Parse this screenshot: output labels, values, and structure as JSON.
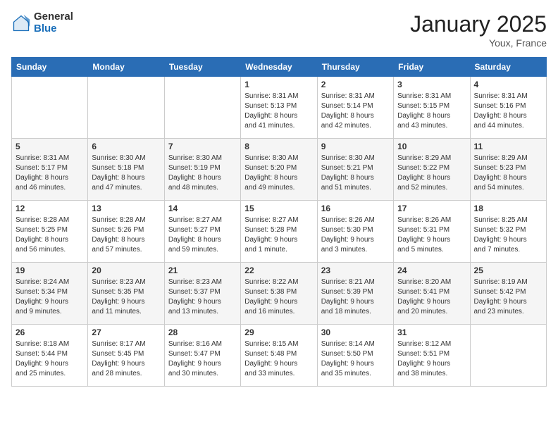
{
  "header": {
    "logo_general": "General",
    "logo_blue": "Blue",
    "month_title": "January 2025",
    "location": "Youx, France"
  },
  "days_of_week": [
    "Sunday",
    "Monday",
    "Tuesday",
    "Wednesday",
    "Thursday",
    "Friday",
    "Saturday"
  ],
  "weeks": [
    [
      {
        "day": "",
        "info": ""
      },
      {
        "day": "",
        "info": ""
      },
      {
        "day": "",
        "info": ""
      },
      {
        "day": "1",
        "info": "Sunrise: 8:31 AM\nSunset: 5:13 PM\nDaylight: 8 hours\nand 41 minutes."
      },
      {
        "day": "2",
        "info": "Sunrise: 8:31 AM\nSunset: 5:14 PM\nDaylight: 8 hours\nand 42 minutes."
      },
      {
        "day": "3",
        "info": "Sunrise: 8:31 AM\nSunset: 5:15 PM\nDaylight: 8 hours\nand 43 minutes."
      },
      {
        "day": "4",
        "info": "Sunrise: 8:31 AM\nSunset: 5:16 PM\nDaylight: 8 hours\nand 44 minutes."
      }
    ],
    [
      {
        "day": "5",
        "info": "Sunrise: 8:31 AM\nSunset: 5:17 PM\nDaylight: 8 hours\nand 46 minutes."
      },
      {
        "day": "6",
        "info": "Sunrise: 8:30 AM\nSunset: 5:18 PM\nDaylight: 8 hours\nand 47 minutes."
      },
      {
        "day": "7",
        "info": "Sunrise: 8:30 AM\nSunset: 5:19 PM\nDaylight: 8 hours\nand 48 minutes."
      },
      {
        "day": "8",
        "info": "Sunrise: 8:30 AM\nSunset: 5:20 PM\nDaylight: 8 hours\nand 49 minutes."
      },
      {
        "day": "9",
        "info": "Sunrise: 8:30 AM\nSunset: 5:21 PM\nDaylight: 8 hours\nand 51 minutes."
      },
      {
        "day": "10",
        "info": "Sunrise: 8:29 AM\nSunset: 5:22 PM\nDaylight: 8 hours\nand 52 minutes."
      },
      {
        "day": "11",
        "info": "Sunrise: 8:29 AM\nSunset: 5:23 PM\nDaylight: 8 hours\nand 54 minutes."
      }
    ],
    [
      {
        "day": "12",
        "info": "Sunrise: 8:28 AM\nSunset: 5:25 PM\nDaylight: 8 hours\nand 56 minutes."
      },
      {
        "day": "13",
        "info": "Sunrise: 8:28 AM\nSunset: 5:26 PM\nDaylight: 8 hours\nand 57 minutes."
      },
      {
        "day": "14",
        "info": "Sunrise: 8:27 AM\nSunset: 5:27 PM\nDaylight: 8 hours\nand 59 minutes."
      },
      {
        "day": "15",
        "info": "Sunrise: 8:27 AM\nSunset: 5:28 PM\nDaylight: 9 hours\nand 1 minute."
      },
      {
        "day": "16",
        "info": "Sunrise: 8:26 AM\nSunset: 5:30 PM\nDaylight: 9 hours\nand 3 minutes."
      },
      {
        "day": "17",
        "info": "Sunrise: 8:26 AM\nSunset: 5:31 PM\nDaylight: 9 hours\nand 5 minutes."
      },
      {
        "day": "18",
        "info": "Sunrise: 8:25 AM\nSunset: 5:32 PM\nDaylight: 9 hours\nand 7 minutes."
      }
    ],
    [
      {
        "day": "19",
        "info": "Sunrise: 8:24 AM\nSunset: 5:34 PM\nDaylight: 9 hours\nand 9 minutes."
      },
      {
        "day": "20",
        "info": "Sunrise: 8:23 AM\nSunset: 5:35 PM\nDaylight: 9 hours\nand 11 minutes."
      },
      {
        "day": "21",
        "info": "Sunrise: 8:23 AM\nSunset: 5:37 PM\nDaylight: 9 hours\nand 13 minutes."
      },
      {
        "day": "22",
        "info": "Sunrise: 8:22 AM\nSunset: 5:38 PM\nDaylight: 9 hours\nand 16 minutes."
      },
      {
        "day": "23",
        "info": "Sunrise: 8:21 AM\nSunset: 5:39 PM\nDaylight: 9 hours\nand 18 minutes."
      },
      {
        "day": "24",
        "info": "Sunrise: 8:20 AM\nSunset: 5:41 PM\nDaylight: 9 hours\nand 20 minutes."
      },
      {
        "day": "25",
        "info": "Sunrise: 8:19 AM\nSunset: 5:42 PM\nDaylight: 9 hours\nand 23 minutes."
      }
    ],
    [
      {
        "day": "26",
        "info": "Sunrise: 8:18 AM\nSunset: 5:44 PM\nDaylight: 9 hours\nand 25 minutes."
      },
      {
        "day": "27",
        "info": "Sunrise: 8:17 AM\nSunset: 5:45 PM\nDaylight: 9 hours\nand 28 minutes."
      },
      {
        "day": "28",
        "info": "Sunrise: 8:16 AM\nSunset: 5:47 PM\nDaylight: 9 hours\nand 30 minutes."
      },
      {
        "day": "29",
        "info": "Sunrise: 8:15 AM\nSunset: 5:48 PM\nDaylight: 9 hours\nand 33 minutes."
      },
      {
        "day": "30",
        "info": "Sunrise: 8:14 AM\nSunset: 5:50 PM\nDaylight: 9 hours\nand 35 minutes."
      },
      {
        "day": "31",
        "info": "Sunrise: 8:12 AM\nSunset: 5:51 PM\nDaylight: 9 hours\nand 38 minutes."
      },
      {
        "day": "",
        "info": ""
      }
    ]
  ]
}
